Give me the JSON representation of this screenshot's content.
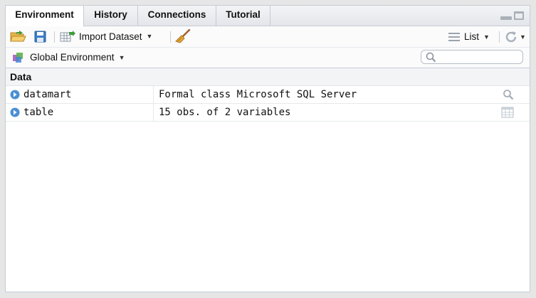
{
  "tabs": [
    {
      "label": "Environment",
      "active": true
    },
    {
      "label": "History",
      "active": false
    },
    {
      "label": "Connections",
      "active": false
    },
    {
      "label": "Tutorial",
      "active": false
    }
  ],
  "toolbar": {
    "import_label": "Import Dataset",
    "view_label": "List"
  },
  "env_selector": {
    "label": "Global Environment"
  },
  "search": {
    "placeholder": ""
  },
  "section_title": "Data",
  "rows": [
    {
      "name": "datamart",
      "value": "Formal class Microsoft SQL Server",
      "action_icon": "search-icon"
    },
    {
      "name": "table",
      "value": "15 obs. of 2 variables",
      "action_icon": "grid-icon"
    }
  ],
  "colors": {
    "accent": "#4a8fd3",
    "border": "#c5ccd4"
  }
}
